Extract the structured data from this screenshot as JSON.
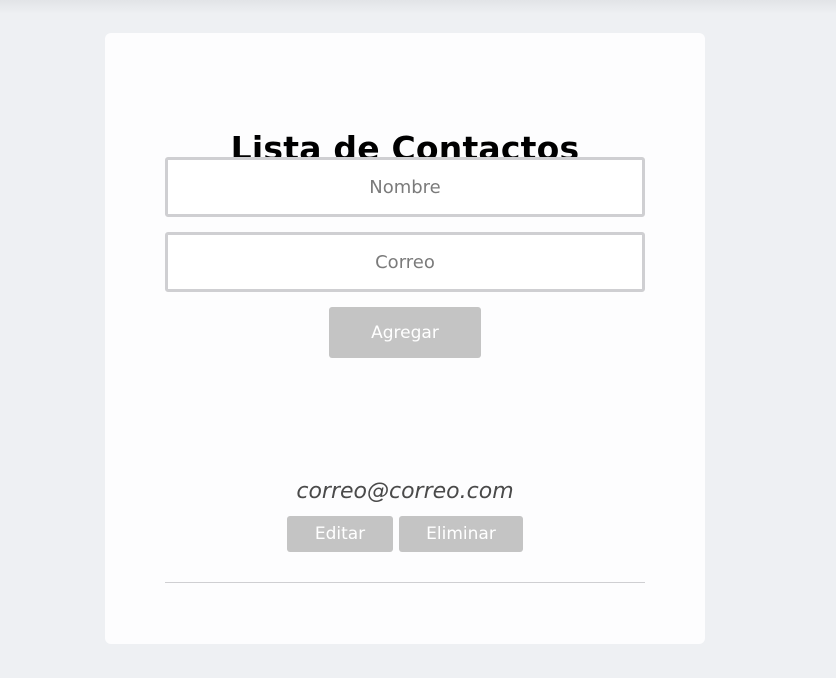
{
  "page": {
    "title": "Lista de Contactos"
  },
  "form": {
    "name_placeholder": "Nombre",
    "name_value": "",
    "email_placeholder": "Correo",
    "email_value": "",
    "add_label": "Agregar"
  },
  "contacts": [
    {
      "name": "",
      "email": "correo@correo.com",
      "edit_label": "Editar",
      "delete_label": "Eliminar"
    }
  ],
  "colors": {
    "page_background": "#eef0f3",
    "card_background": "#fdfdfe",
    "button_background": "#c4c4c4",
    "button_text": "#ffffff",
    "input_border": "#cfcfd2"
  }
}
